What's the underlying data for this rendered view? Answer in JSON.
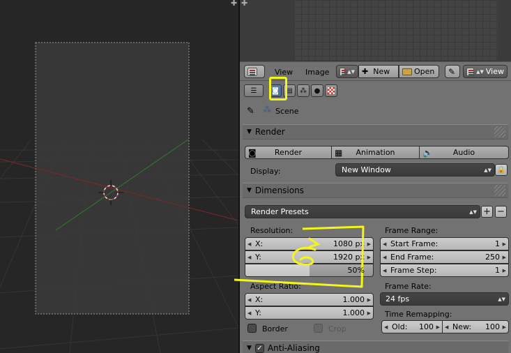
{
  "header": {
    "menu_view": "View",
    "menu_image": "Image",
    "btn_new": "New",
    "btn_open": "Open",
    "btn_view": "View"
  },
  "context": {
    "scene_label": "Scene"
  },
  "render_panel": {
    "title": "Render",
    "btn_render": "Render",
    "btn_animation": "Animation",
    "btn_audio": "Audio",
    "display_label": "Display:",
    "display_value": "New Window"
  },
  "dimensions_panel": {
    "title": "Dimensions",
    "presets": "Render Presets",
    "resolution_label": "Resolution:",
    "res_x_label": "X:",
    "res_x_value": "1080 px",
    "res_y_label": "Y:",
    "res_y_value": "1920 px",
    "res_percent": "50%",
    "res_percent_value": 0.5,
    "aspect_label": "Aspect Ratio:",
    "aspect_x_label": "X:",
    "aspect_x_value": "1.000",
    "aspect_y_label": "Y:",
    "aspect_y_value": "1.000",
    "border_label": "Border",
    "crop_label": "Crop",
    "frame_range_label": "Frame Range:",
    "start_label": "Start Frame:",
    "start_value": "1",
    "end_label": "End Frame:",
    "end_value": "250",
    "step_label": "Frame Step:",
    "step_value": "1",
    "frame_rate_label": "Frame Rate:",
    "frame_rate_value": "24 fps",
    "time_remap_label": "Time Remapping:",
    "old_label": "Old:",
    "old_value": "100",
    "new_label": "New:",
    "new_value": "100"
  },
  "aa_panel": {
    "title": "Anti-Aliasing"
  },
  "colors": {
    "annotation": "#f4f51b",
    "panel_bg": "#727272",
    "active_tab": "#5f7fa8"
  }
}
